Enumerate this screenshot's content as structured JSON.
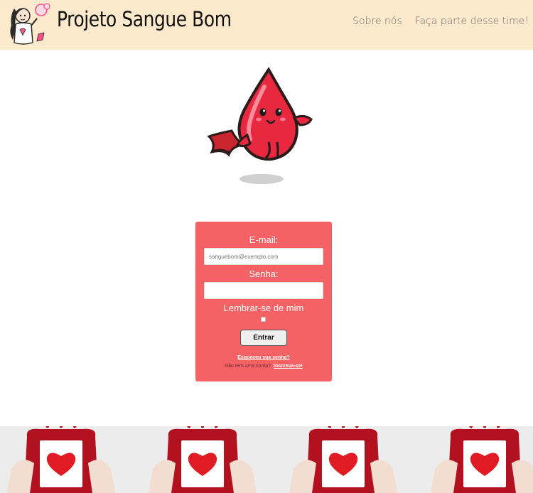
{
  "header": {
    "title": "Projeto Sangue Bom",
    "nav": [
      {
        "label": "Sobre nós"
      },
      {
        "label": "Faça parte desse time!"
      }
    ]
  },
  "login": {
    "email_label": "E-mail:",
    "email_placeholder": "sanguebom@exemplo.com",
    "password_label": "Senha:",
    "remember_label": "Lembrar-se de mim",
    "submit_label": "Entrar",
    "forgot_link": "Esqueceu sua senha?",
    "no_account_text": "Não tem uma conta?",
    "signup_link": "Inscreva-se!"
  },
  "colors": {
    "header_bg": "#fde9cc",
    "card_bg": "#f46265",
    "drop_red": "#e8283f"
  },
  "icons": {
    "logo": "blood-donor-mascot-icon",
    "hero": "flying-blood-drop-icon",
    "banner": "blood-bag-heart-icon"
  }
}
